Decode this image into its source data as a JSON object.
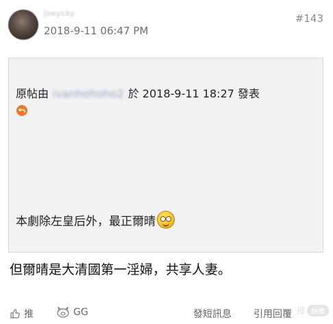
{
  "post": {
    "username": "Joeycky",
    "timestamp": "2018-9-11 06:47 PM",
    "number": "#143"
  },
  "quote": {
    "prefix": "原帖由",
    "quoted_user": "ivanhohoho2",
    "mid": "於 2018-9-11 18:27 發表",
    "text": "本劇除左皇后外，最正爾晴"
  },
  "reply": {
    "text": "但爾晴是大清國第一淫婦，共享人妻。"
  },
  "actions": {
    "like": "推",
    "gg": "GG",
    "message": "發短訊息",
    "quote_reply": "引用回覆"
  },
  "watermark": {
    "left": "揭",
    "right": "娛樂"
  },
  "colors": {
    "quote_bg": "#f2f2f2",
    "reply_icon": "#f07a2a",
    "muted": "#666666"
  }
}
